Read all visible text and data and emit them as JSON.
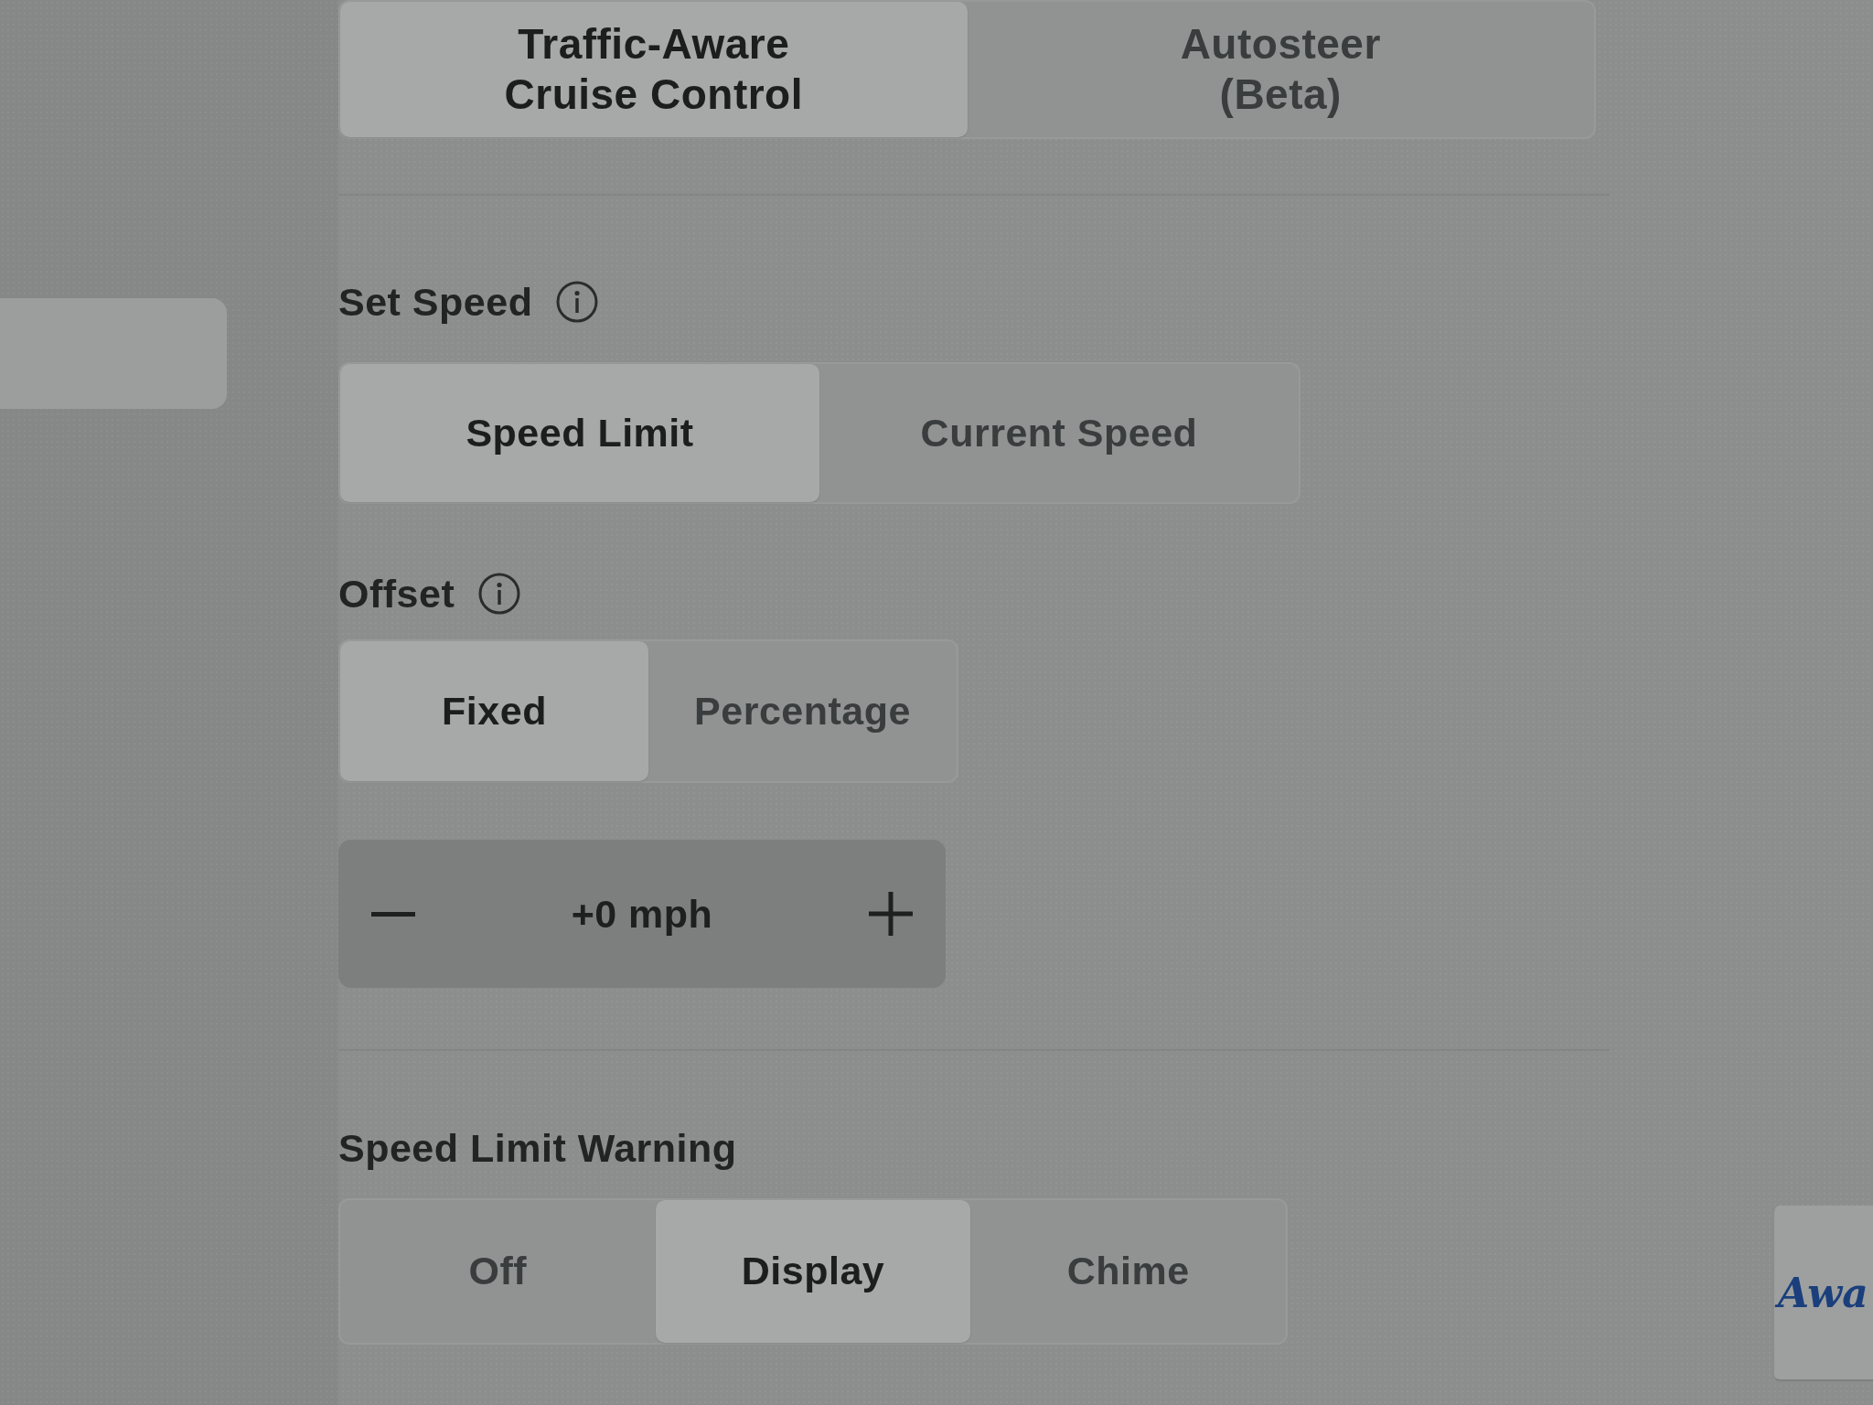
{
  "sidebar": {
    "items": [
      {
        "selected": true
      }
    ]
  },
  "driving_modes": [
    {
      "label": "Traffic-Aware\nCruise Control",
      "selected": true
    },
    {
      "label": "Autosteer\n(Beta)",
      "selected": false
    }
  ],
  "set_speed": {
    "label": "Set Speed",
    "options": [
      {
        "label": "Speed Limit",
        "selected": true
      },
      {
        "label": "Current Speed",
        "selected": false
      }
    ]
  },
  "offset": {
    "label": "Offset",
    "options": [
      {
        "label": "Fixed",
        "selected": true
      },
      {
        "label": "Percentage",
        "selected": false
      }
    ],
    "stepper": {
      "value": "+0 mph"
    }
  },
  "speed_limit_warning": {
    "label": "Speed Limit Warning",
    "options": [
      {
        "label": "Off",
        "selected": false
      },
      {
        "label": "Display",
        "selected": true
      },
      {
        "label": "Chime",
        "selected": false
      }
    ]
  },
  "side_card": {
    "text": "Awa"
  }
}
